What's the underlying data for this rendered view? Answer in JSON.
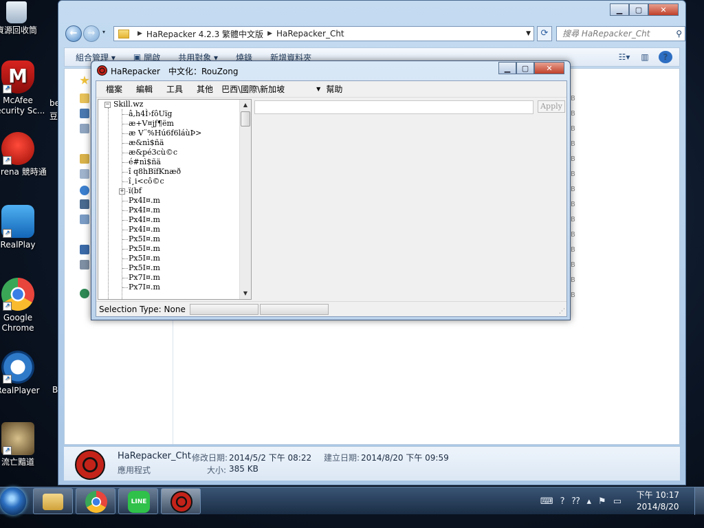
{
  "desktop": {
    "icons": [
      {
        "label": "資源回收筒",
        "icon": "recycle-bin-icon"
      },
      {
        "label": "McAfee Security Sc...",
        "icon": "mcafee-icon"
      },
      {
        "label": "Garena 競時通",
        "icon": "garena-icon"
      },
      {
        "label": "RealPlay",
        "icon": "realplay-icon"
      },
      {
        "label": "Google Chrome",
        "icon": "chrome-icon"
      },
      {
        "label": "RealPlayer",
        "icon": "realplayer-icon"
      },
      {
        "label": "流亡黯道",
        "icon": "poe-icon"
      }
    ],
    "partial_labels": [
      "be",
      "豆",
      "B"
    ]
  },
  "explorer": {
    "address": {
      "part1": "HaRepacker 4.2.3 繁體中文版",
      "part2": "HaRepacker_Cht"
    },
    "search_placeholder": "搜尋 HaRepacker_Cht",
    "commands": {
      "organize": "組合管理 ▾",
      "open": "開啟",
      "share": "共用對象 ▾",
      "burn": "燒錄",
      "new_folder": "新增資料夾"
    },
    "details": {
      "name": "HaRepacker_Cht",
      "modified_label": "修改日期:",
      "modified_value": "2014/5/2 下午 08:22",
      "created_label": "建立日期:",
      "created_value": "2014/8/20 下午 09:59",
      "type": "應用程式",
      "size_label": "大小:",
      "size_value": "385 KB"
    },
    "column_fragment": "B"
  },
  "harepacker": {
    "title": "HaRepacker　中文化：RouZong",
    "menu": {
      "file": "檔案",
      "edit": "編輯",
      "tools": "工具",
      "other": "其他",
      "region": "巴西\\國際\\新加坡",
      "help": "幫助"
    },
    "apply_label": "Apply",
    "status_label": "Selection Type: None",
    "tree": {
      "root": "Skill.wz",
      "children": [
        "â,h4Ì›fôUïg",
        "æ+V¤jƒ¶ëm",
        "æ V¨%Hú6f6láùÞ>",
        "æ&nì$ñä",
        "æ&pé3cù©c",
        "é#nì$ñä",
        "î q8hBïfKnæð",
        "î¸i<cô©c",
        "ï(bf",
        "Px4I¤.m",
        "Px4I¤.m",
        "Px4I¤.m",
        "Px4I¤.m",
        "Px5I¤.m",
        "Px5I¤.m",
        "Px5I¤.m",
        "Px5I¤.m",
        "Px7I¤.m",
        "Px7I¤.m"
      ]
    }
  },
  "taskbar": {
    "time": "下午 10:17",
    "date": "2014/8/20",
    "apps": [
      "explorer-taskbar-icon",
      "chrome-taskbar-icon",
      "line-taskbar-icon",
      "harepacker-taskbar-icon"
    ],
    "line_label": "LINE"
  },
  "colors": {
    "accent": "#2d6ec2",
    "close_red": "#c0402a",
    "harepacker_red": "#c4231a"
  }
}
